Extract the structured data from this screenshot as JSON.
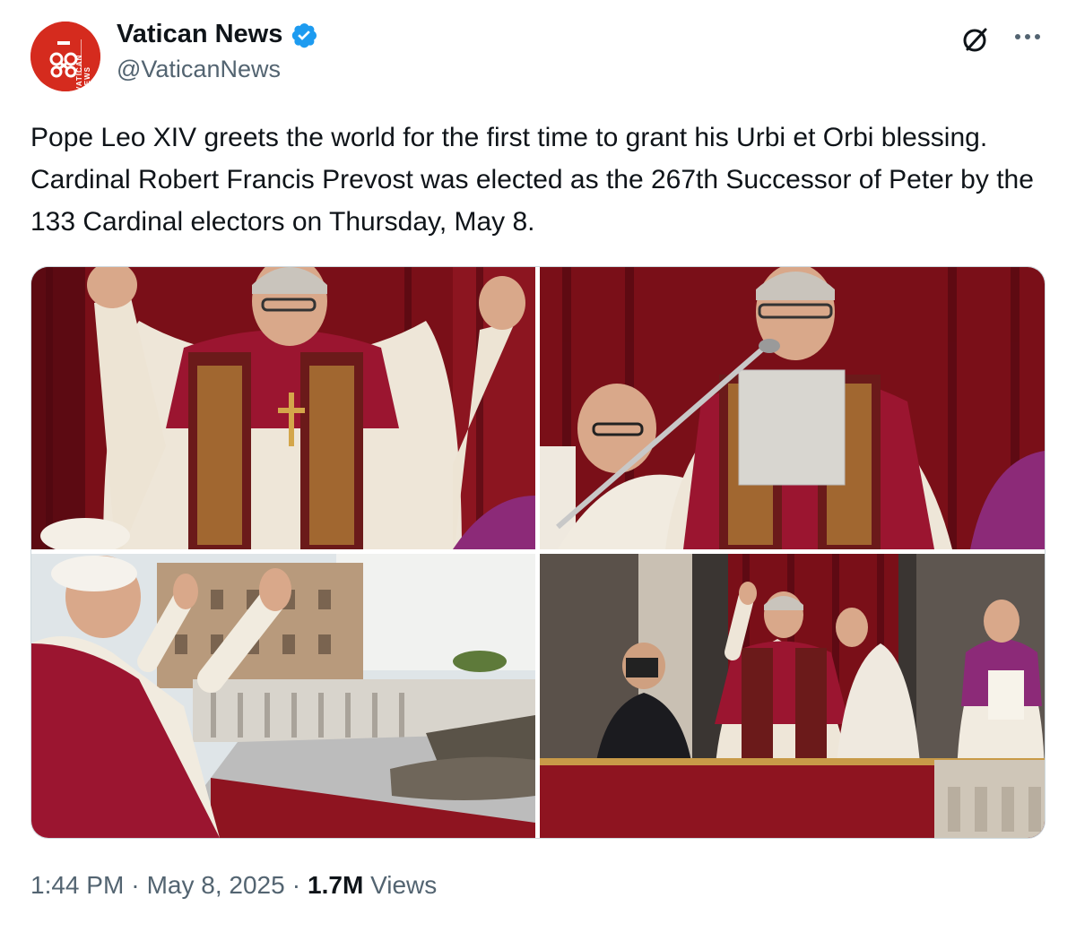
{
  "account": {
    "name": "Vatican News",
    "handle": "@VaticanNews",
    "verified": true,
    "avatar_text": "VATICAN NEWS",
    "brand_color": "#d52b1e",
    "verified_color": "#1d9bf0"
  },
  "post": {
    "text": "Pope Leo XIV greets the world for the first time to grant his Urbi et Orbi blessing. Cardinal Robert Francis Prevost was elected as the 267th Successor of Peter by the 133 Cardinal electors on Thursday, May 8."
  },
  "media": {
    "photos": [
      {
        "icon": "photo-pope-waving"
      },
      {
        "icon": "photo-pope-speaking-microphone"
      },
      {
        "icon": "photo-pope-balcony-st-peters-square"
      },
      {
        "icon": "photo-pope-balcony-photographer"
      }
    ]
  },
  "footer": {
    "time": "1:44 PM",
    "sep1": "·",
    "date": "May 8, 2025",
    "sep2": "·",
    "views_count": "1.7M",
    "views_label": "Views"
  },
  "icons": {
    "grok": "grok-icon",
    "more": "more-icon",
    "verified": "verified-badge-icon"
  }
}
